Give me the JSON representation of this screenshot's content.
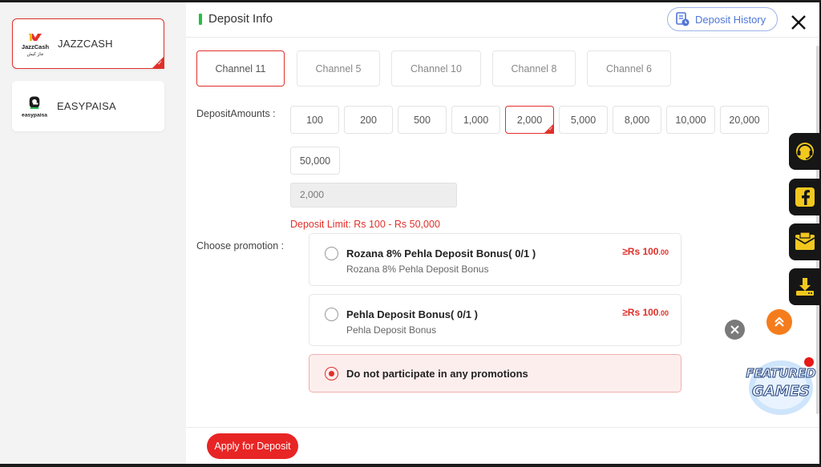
{
  "payment_methods": [
    {
      "label": "JAZZCASH",
      "logo_icon": "jazzcash-logo",
      "logo_text": "JazzCash",
      "logo_subtext": "جاز کیش",
      "selected": true
    },
    {
      "label": "EASYPAISA",
      "logo_icon": "easypaisa-logo",
      "logo_text": "easypaisa",
      "selected": false
    }
  ],
  "header": {
    "title": "Deposit Info",
    "history_button": "Deposit History",
    "close_icon": "close-icon"
  },
  "channels": [
    {
      "label": "Channel 11",
      "active": true
    },
    {
      "label": "Channel 5",
      "active": false
    },
    {
      "label": "Channel 10",
      "active": false
    },
    {
      "label": "Channel 8",
      "active": false
    },
    {
      "label": "Channel 6",
      "active": false
    }
  ],
  "deposit": {
    "amounts_label": "DepositAmounts :",
    "amounts": [
      "100",
      "200",
      "500",
      "1,000",
      "2,000",
      "5,000",
      "8,000",
      "10,000",
      "20,000",
      "50,000"
    ],
    "selected_amount": "2,000",
    "input_value": "2,000",
    "limit_text": "Deposit Limit:  Rs  100  -  Rs  50,000"
  },
  "promotion": {
    "label": "Choose promotion :",
    "options": [
      {
        "title": "Rozana 8% Pehla Deposit Bonus( 0/1 )",
        "subtitle": "Rozana 8% Pehla Deposit Bonus",
        "min_amount": "≥Rs  100",
        "min_decimals": ".00"
      },
      {
        "title": "Pehla Deposit Bonus( 0/1 )",
        "subtitle": "Pehla Deposit Bonus",
        "min_amount": "≥Rs  100",
        "min_decimals": ".00"
      }
    ],
    "none_option": "Do not participate in any promotions",
    "selected": "none"
  },
  "footer": {
    "apply_button": "Apply for Deposit"
  },
  "side_buttons": [
    "support-icon",
    "facebook-icon",
    "message-icon",
    "download-icon"
  ],
  "floating": {
    "featured_line1": "FEATURED",
    "featured_line2": "GAMES"
  },
  "colors": {
    "accent": "#e0302a",
    "header_bar": "#1fc243",
    "history_blue": "#5076d8",
    "scroll_top": "#f57c1c",
    "side_icon": "#f2c81e"
  }
}
